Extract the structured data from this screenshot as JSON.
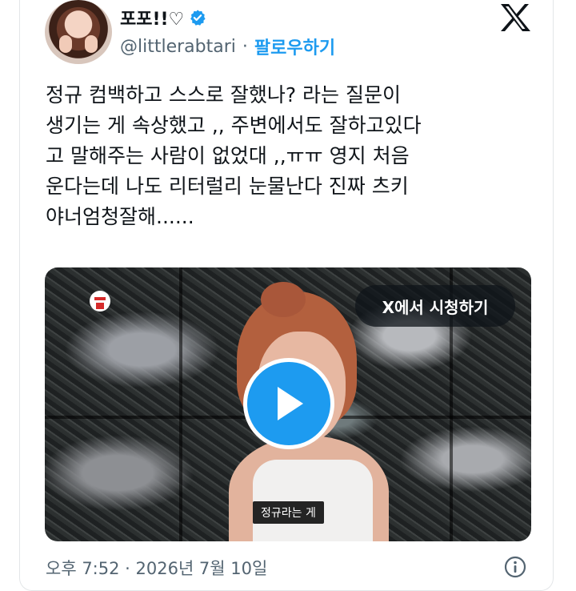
{
  "tweet": {
    "display_name": "포포!!♡",
    "handle": "@littlerabtari",
    "separator": "·",
    "follow_label": "팔로우하기",
    "text_lines": [
      "정규 컴백하고 스스로 잘했나? 라는 질문이",
      "생기는 게 속상했고 ,, 주변에서도 잘하고있다",
      "고 말해주는 사람이 없었대 ,,ㅠㅠ 영지 처음",
      "운다는데 나도 리터럴리 눈물난다 진짜 츠키",
      "야너엄청잘해......"
    ],
    "timestamp": "오후 7:52 · 2026년 7월 10일"
  },
  "media": {
    "watch_on_x_label": "X에서 시청하기",
    "subtitle": "정규라는 게"
  },
  "colors": {
    "accent": "#1d9bf0",
    "text": "#0f1419",
    "secondary": "#536471"
  },
  "icons": {
    "verified": "verified-badge-icon",
    "x_logo": "x-logo-icon",
    "play": "play-icon",
    "info": "info-icon"
  }
}
